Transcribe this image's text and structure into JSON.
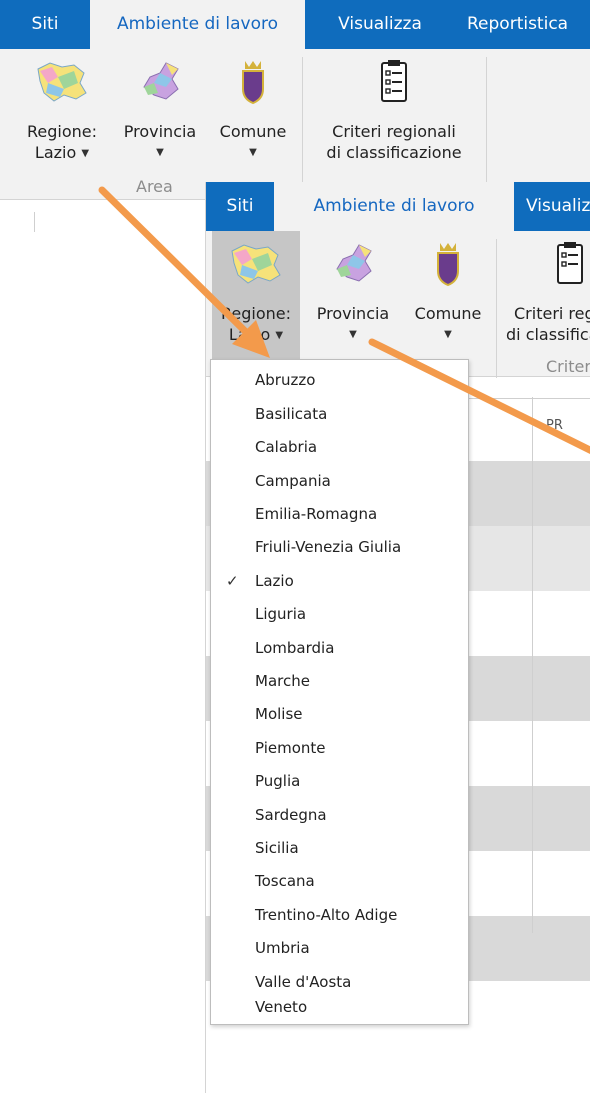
{
  "tabs": [
    {
      "label": "Siti",
      "active": false
    },
    {
      "label": "Ambiente di lavoro",
      "active": true
    },
    {
      "label": "Visualizza",
      "active": false
    },
    {
      "label": "Reportistica",
      "active": false
    }
  ],
  "ribbon": {
    "regione_label": "Regione:",
    "regione_value": "Lazio",
    "provincia_label": "Provincia",
    "comune_label": "Comune",
    "criteri_line1": "Criteri regionali",
    "criteri_line2": "di classificazione",
    "group_area": "Area",
    "group_criteri": "Criteri"
  },
  "grid": {
    "column_header": "PR"
  },
  "dropdown": {
    "selected": "Lazio",
    "items": [
      "Abruzzo",
      "Basilicata",
      "Calabria",
      "Campania",
      "Emilia-Romagna",
      "Friuli-Venezia Giulia",
      "Lazio",
      "Liguria",
      "Lombardia",
      "Marche",
      "Molise",
      "Piemonte",
      "Puglia",
      "Sardegna",
      "Sicilia",
      "Toscana",
      "Trentino-Alto Adige",
      "Umbria",
      "Valle d'Aosta",
      "Veneto"
    ]
  },
  "colors": {
    "ribbon_blue": "#0f6cbd",
    "arrow_orange": "#f39a4b",
    "row_shade": "#d9d9d9"
  }
}
